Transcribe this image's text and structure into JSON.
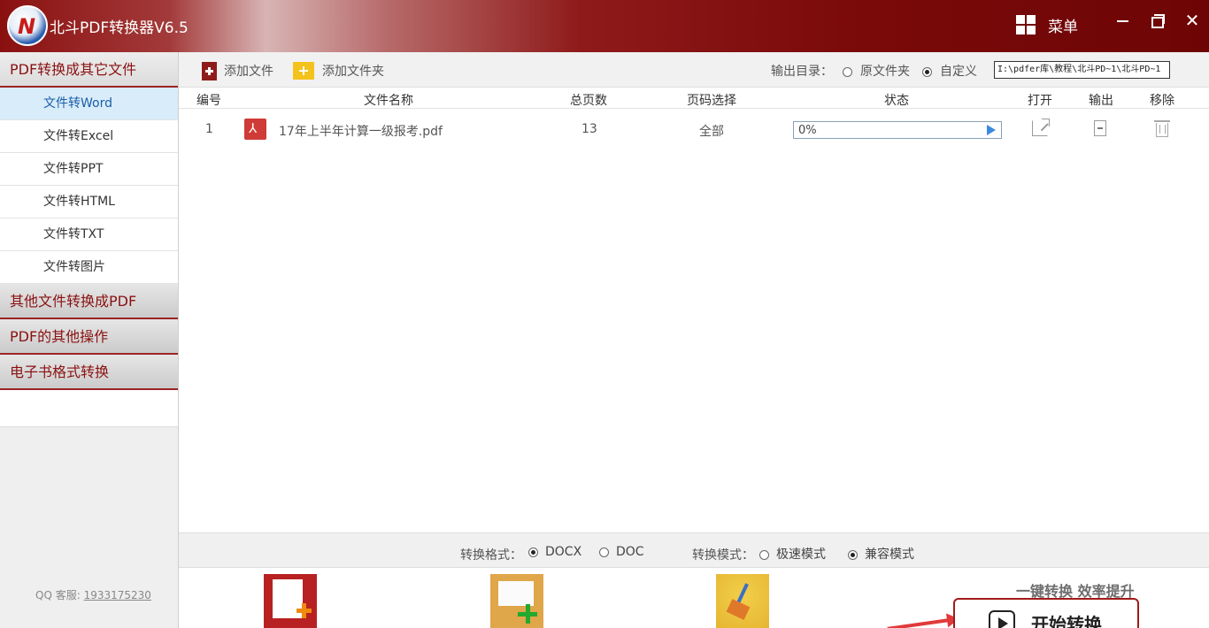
{
  "app": {
    "title": "北斗PDF转换器V6.5",
    "menu_label": "菜单"
  },
  "sidebar": {
    "sections": [
      {
        "label": "PDF转换成其它文件"
      },
      {
        "label": "其他文件转换成PDF"
      },
      {
        "label": "PDF的其他操作"
      },
      {
        "label": "电子书格式转换"
      }
    ],
    "items": [
      {
        "label": "文件转Word",
        "active": true
      },
      {
        "label": "文件转Excel"
      },
      {
        "label": "文件转PPT"
      },
      {
        "label": "文件转HTML"
      },
      {
        "label": "文件转TXT"
      },
      {
        "label": "文件转图片"
      }
    ],
    "qq_label": "QQ 客服:",
    "qq_number": "1933175230"
  },
  "toolbar": {
    "add_file_label": "添加文件",
    "add_folder_label": "添加文件夹",
    "output_label": "输出目录：",
    "output_opt_original": "原文件夹",
    "output_opt_custom": "自定义",
    "output_selected": "自定义",
    "output_path": "I:\\pdfer库\\教程\\北斗PD~1\\北斗PD~1"
  },
  "table": {
    "headers": [
      "编号",
      "文件名称",
      "总页数",
      "页码选择",
      "状态",
      "打开",
      "输出",
      "移除"
    ],
    "rows": [
      {
        "index": "1",
        "filename": "17年上半年计算一级报考.pdf",
        "pages": "13",
        "page_select": "全部",
        "status_text": "0%",
        "progress": 0
      }
    ]
  },
  "format_bar": {
    "format_label": "转换格式：",
    "format_options": [
      "DOCX",
      "DOC"
    ],
    "format_selected": "DOCX",
    "mode_label": "转换模式：",
    "mode_options": [
      "极速模式",
      "兼容模式"
    ],
    "mode_selected": "兼容模式"
  },
  "actions": {
    "slogan": "一键转换  效率提升",
    "start_label": "开始转换"
  },
  "icons": [
    "logo-icon",
    "grid-menu-icon",
    "minimize-icon",
    "maximize-icon",
    "close-icon",
    "add-file-icon",
    "add-folder-icon",
    "pdf-file-icon",
    "play-icon",
    "open-icon",
    "output-icon",
    "trash-icon",
    "add-document-icon",
    "add-folder-large-icon",
    "clear-broom-icon",
    "play-square-icon",
    "arrow-icon"
  ],
  "colors": {
    "brand": "#8a1010",
    "active_item_bg": "#d9ecf9",
    "active_item_text": "#1a5ea8",
    "progress": "#5aa0e6"
  }
}
